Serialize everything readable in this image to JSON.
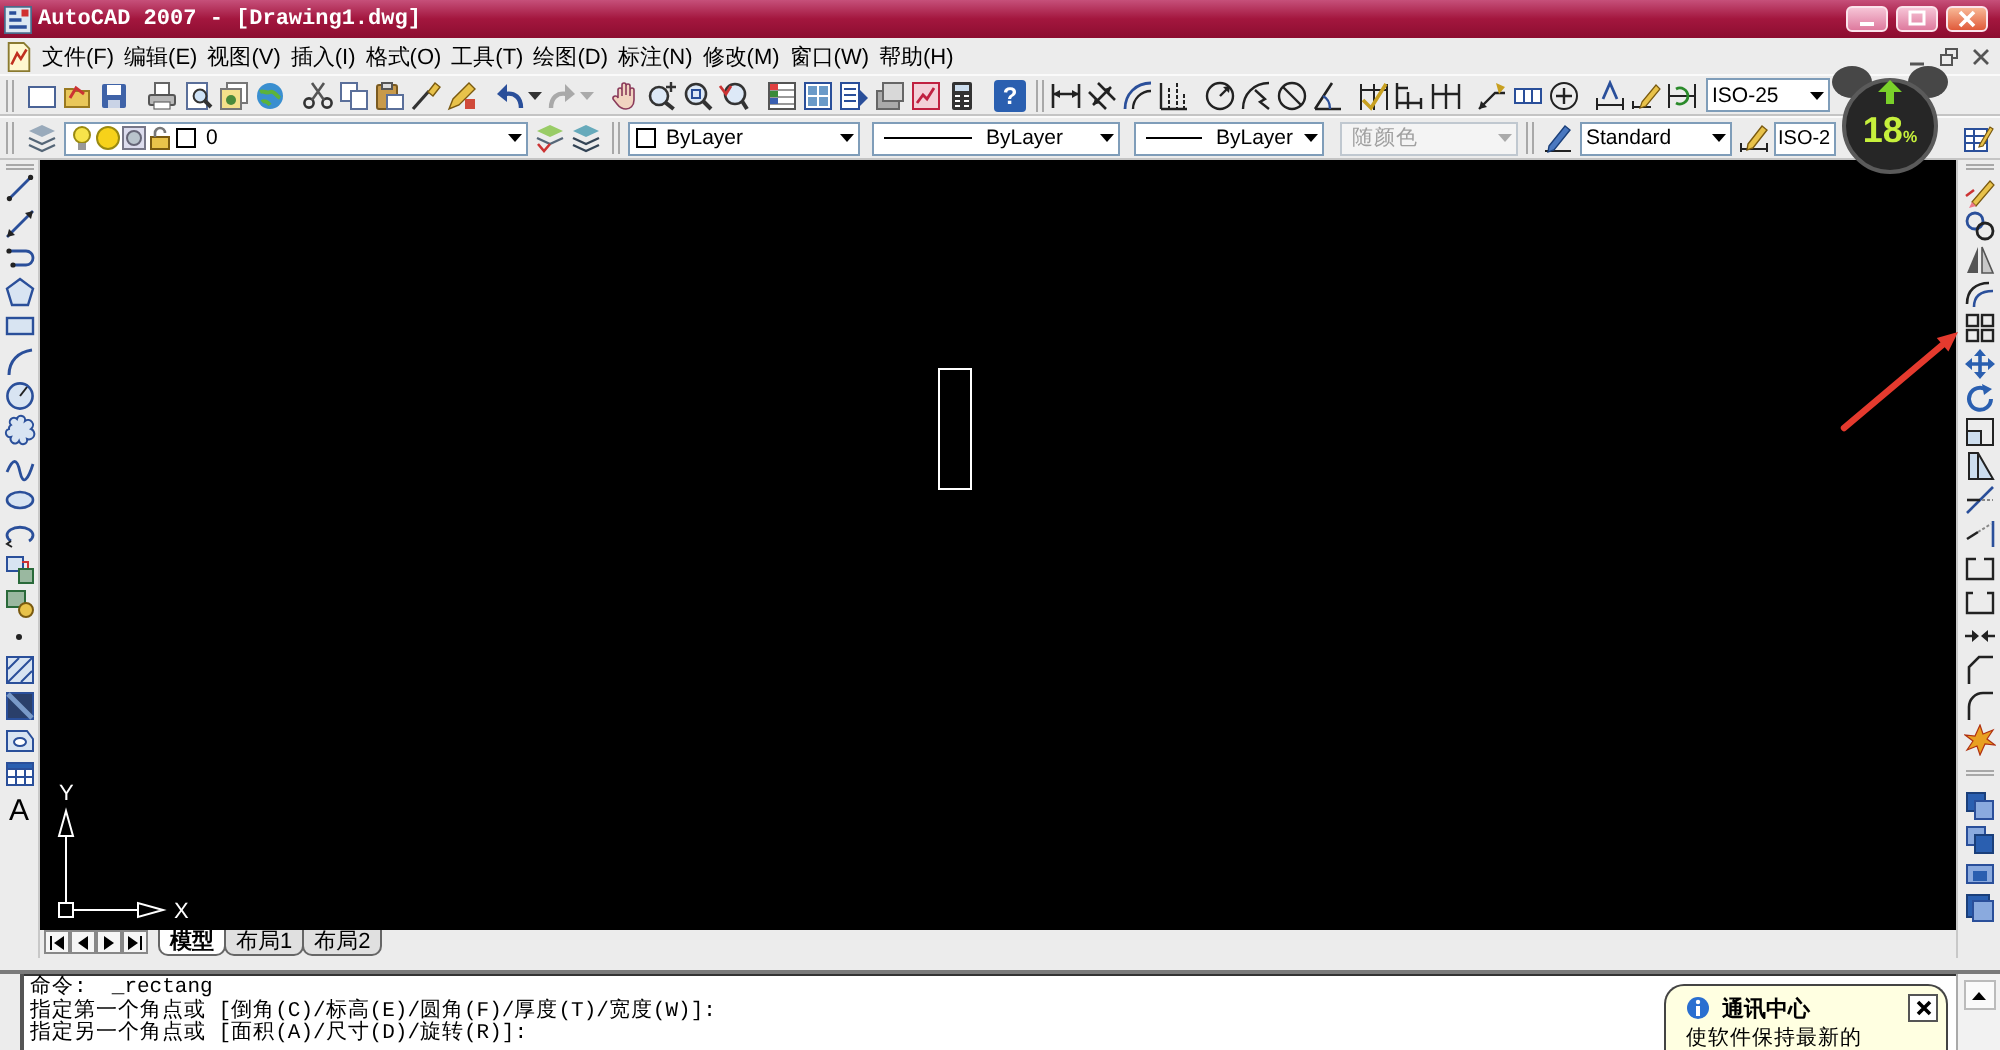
{
  "window": {
    "title": "AutoCAD 2007 - [Drawing1.dwg]"
  },
  "menu_bar": {
    "items": [
      "文件(F)",
      "编辑(E)",
      "视图(V)",
      "插入(I)",
      "格式(O)",
      "工具(T)",
      "绘图(D)",
      "标注(N)",
      "修改(M)",
      "窗口(W)",
      "帮助(H)"
    ]
  },
  "standard_toolbar": {
    "help_glyph": "?"
  },
  "dimension_toolbar": {
    "dimension_style": "ISO-25"
  },
  "layers_toolbar": {
    "current_layer": "0"
  },
  "properties_toolbar": {
    "dropdowns": [
      {
        "kind": "color",
        "value": "ByLayer",
        "disabled": false
      },
      {
        "kind": "linetype",
        "value": "ByLayer",
        "disabled": false
      },
      {
        "kind": "lineweight",
        "value": "ByLayer",
        "disabled": false
      },
      {
        "kind": "plot_style",
        "value": "随颜色",
        "disabled": true
      }
    ]
  },
  "styles_toolbar": {
    "text_style": "Standard",
    "dimension_style": "ISO-2"
  },
  "draw_toolbar": {
    "text_glyph": "A"
  },
  "model_space": {
    "ucs_icon": {
      "y_label": "Y",
      "x_label": "X"
    }
  },
  "layout_tabs": [
    {
      "label": "模型",
      "selected": true
    },
    {
      "label": "布局1",
      "selected": false
    },
    {
      "label": "布局2",
      "selected": false
    }
  ],
  "command_window": {
    "lines": [
      "命令:  _rectang",
      "指定第一个角点或 [倒角(C)/标高(E)/圆角(F)/厚度(T)/宽度(W)]:",
      "指定另一个角点或 [面积(A)/尺寸(D)/旋转(R)]:"
    ]
  },
  "notification": {
    "title": "通讯中心",
    "text": "使软件保持最新的"
  },
  "desktop_widget": {
    "value": "18",
    "unit": "%"
  }
}
